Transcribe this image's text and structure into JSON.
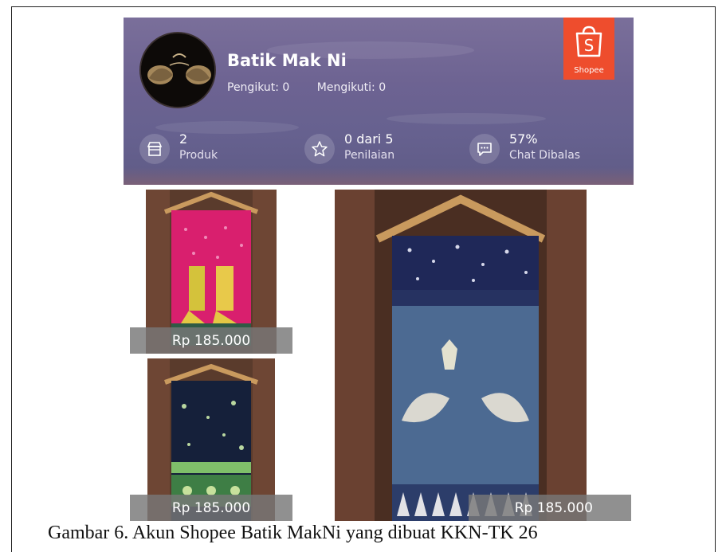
{
  "shop": {
    "name": "Batik Mak Ni",
    "followers": "Pengikut: 0",
    "following": "Mengikuti: 0",
    "logo_text": "Shopee"
  },
  "stats": [
    {
      "icon": "store-icon",
      "value": "2",
      "label": "Produk"
    },
    {
      "icon": "star-icon",
      "value": "0 dari 5",
      "label": "Penilaian"
    },
    {
      "icon": "chat-icon",
      "value": "57%",
      "label": "Chat Dibalas"
    }
  ],
  "products": [
    {
      "name": "batik-pink",
      "price": "Rp 185.000"
    },
    {
      "name": "batik-navy-green",
      "price": "Rp 185.000"
    },
    {
      "name": "batik-blue-peacock",
      "price": "Rp 185.000"
    }
  ],
  "caption": "Gambar 6. Akun Shopee Batik MakNi yang dibuat KKN-TK 26",
  "colors": {
    "brand": "#ee4d2d",
    "header": "#6d6392",
    "price_bar": "#787878"
  }
}
